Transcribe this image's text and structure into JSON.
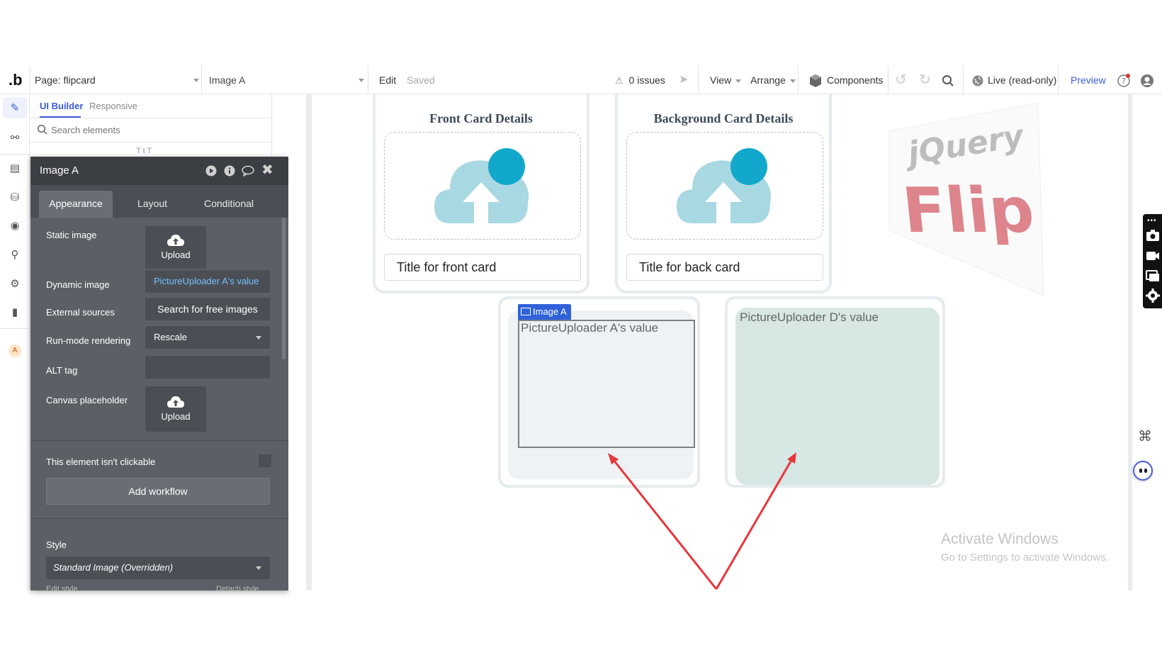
{
  "topbar": {
    "logo": ".b",
    "page_selector": "Page: flipcard",
    "element_selector": "Image A",
    "edit_label": "Edit",
    "saved_label": "Saved",
    "issues_label": "0 issues",
    "view_label": "View",
    "arrange_label": "Arrange",
    "components_label": "Components",
    "live_label": "Live (read-only)",
    "preview_label": "Preview"
  },
  "treepanel": {
    "tabs": [
      "UI Builder",
      "Responsive"
    ],
    "search_placeholder": "Search elements",
    "partial_row": "T    t    T"
  },
  "rail": {
    "badge": "A"
  },
  "editor": {
    "title": "Image A",
    "tabs": [
      "Appearance",
      "Layout",
      "Conditional"
    ],
    "static_image_label": "Static image",
    "upload_label": "Upload",
    "dynamic_image_label": "Dynamic image",
    "dynamic_image_value": "PictureUploader A's value",
    "external_sources_label": "External sources",
    "search_free_images": "Search for free images",
    "run_mode_label": "Run-mode rendering",
    "run_mode_value": "Rescale",
    "alt_tag_label": "ALT tag",
    "alt_tag_value": "",
    "canvas_placeholder_label": "Canvas placeholder",
    "canvas_upload_label": "Upload",
    "not_clickable_label": "This element isn't clickable",
    "add_workflow": "Add workflow",
    "style_label": "Style",
    "style_value": "Standard Image (Overridden)",
    "edit_style": "Edit style",
    "detach_style": "Detach style"
  },
  "canvas": {
    "front_title": "Front Card Details",
    "back_title": "Background Card Details",
    "front_input": "Title for front card",
    "back_input": "Title for back card",
    "image_a_tag": "Image A",
    "image_a_text": "PictureUploader A's value",
    "image_d_text": "PictureUploader D's value",
    "jquery_text": "jQuery",
    "flip_text": "Flip",
    "watermark_title": "Activate Windows",
    "watermark_sub": "Go to Settings to activate Windows."
  },
  "colors": {
    "accent_blue": "#3b5bdb",
    "editor_bg": "#5c6066",
    "front_face": "#eef2f4",
    "back_face": "#d6e7e4",
    "cloud_light": "#a8d8e2",
    "cloud_dark": "#12a8cc",
    "arrow_red": "#e8363a",
    "flip_pink": "#d9707a"
  }
}
